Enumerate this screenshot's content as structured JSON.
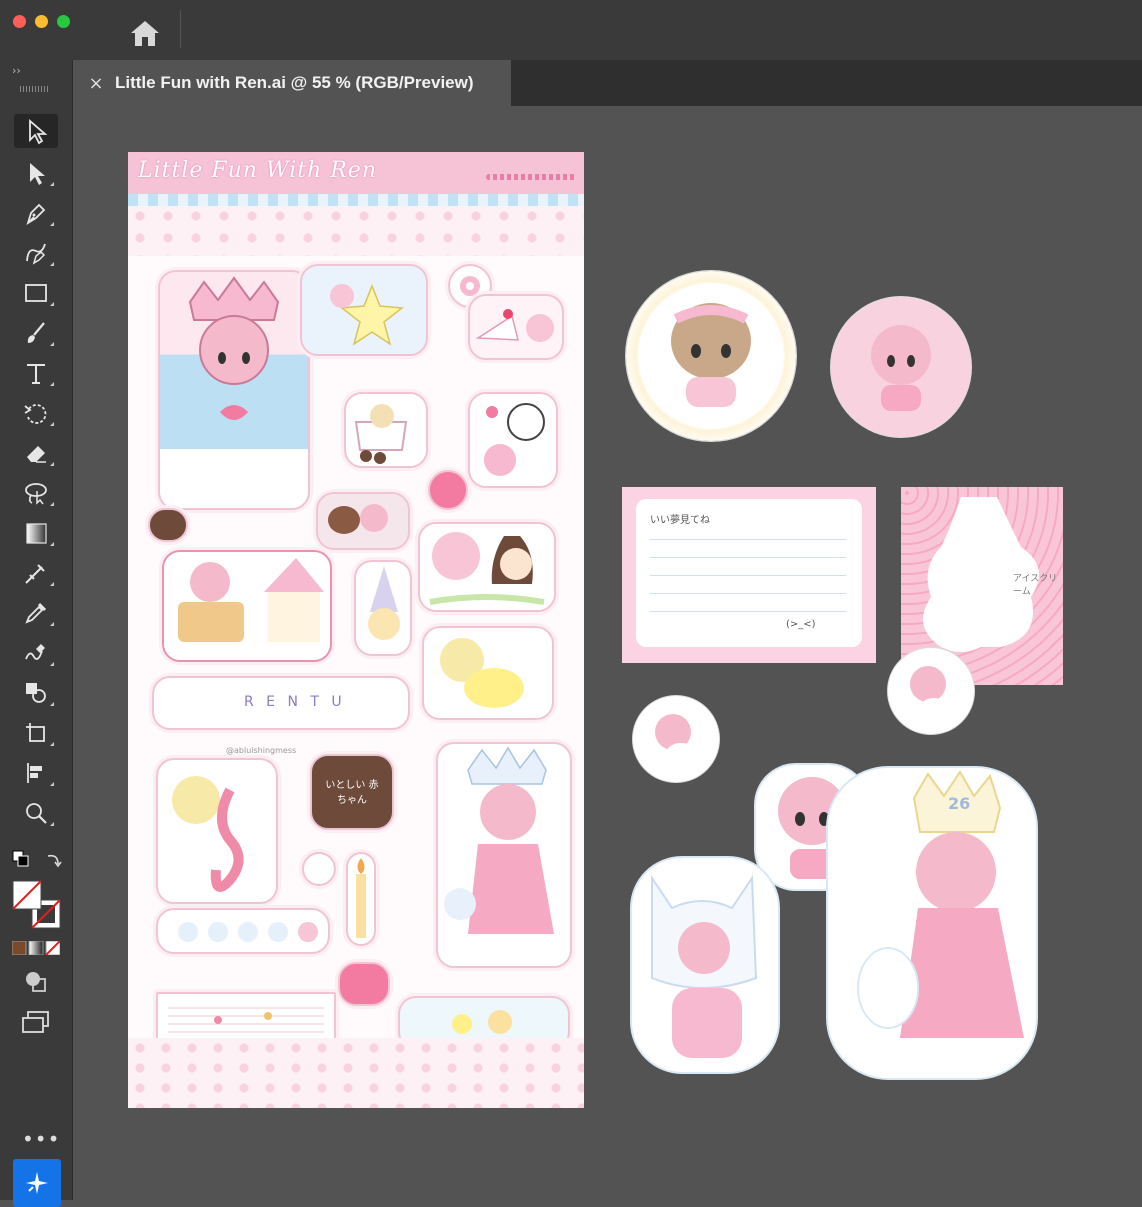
{
  "window": {
    "title_bar": {
      "home_icon": "home-icon"
    },
    "colors": {
      "red": "#ff5f57",
      "yellow": "#febc2e",
      "green": "#28c840",
      "accent": "#1473e6"
    }
  },
  "document_tab": {
    "title": "Little Fun with Ren.ai @ 55 % (RGB/Preview)",
    "close_glyph": "×"
  },
  "toolbar": {
    "collapse_glyph": "››",
    "more_glyph": "•••",
    "tools": [
      {
        "name": "selection-tool",
        "icon": "arrow-icon",
        "active": true
      },
      {
        "name": "direct-selection-tool",
        "icon": "direct-select-icon"
      },
      {
        "name": "pen-tool",
        "icon": "pen-icon"
      },
      {
        "name": "curvature-tool",
        "icon": "curvature-icon"
      },
      {
        "name": "rectangle-tool",
        "icon": "rectangle-icon"
      },
      {
        "name": "paintbrush-tool",
        "icon": "brush-icon"
      },
      {
        "name": "type-tool",
        "icon": "type-icon",
        "label": "T"
      },
      {
        "name": "rotate-tool",
        "icon": "rotate-icon"
      },
      {
        "name": "eraser-tool",
        "icon": "eraser-icon"
      },
      {
        "name": "lasso-tool",
        "icon": "lasso-icon"
      },
      {
        "name": "gradient-tool",
        "icon": "gradient-icon"
      },
      {
        "name": "mesh-tool",
        "icon": "mesh-icon"
      },
      {
        "name": "eyedropper-tool",
        "icon": "eyedropper-icon"
      },
      {
        "name": "blend-tool",
        "icon": "blend-icon"
      },
      {
        "name": "shape-builder-tool",
        "icon": "shape-builder-icon"
      },
      {
        "name": "artboard-tool",
        "icon": "artboard-icon"
      },
      {
        "name": "graph-tool",
        "icon": "graph-icon"
      },
      {
        "name": "zoom-tool",
        "icon": "zoom-icon"
      }
    ]
  },
  "artwork": {
    "sheet_title": "Little Fun With Ren",
    "credit": "@abluishingmess",
    "sticker_text_heart": "いとしい 赤ちゃん",
    "sticker_text_banner": "R E N T U",
    "memo_heading": "いい夢見てね",
    "memo_sign": "(>_<)",
    "tag_text": "アイスクリーム",
    "crown_number": "26"
  }
}
